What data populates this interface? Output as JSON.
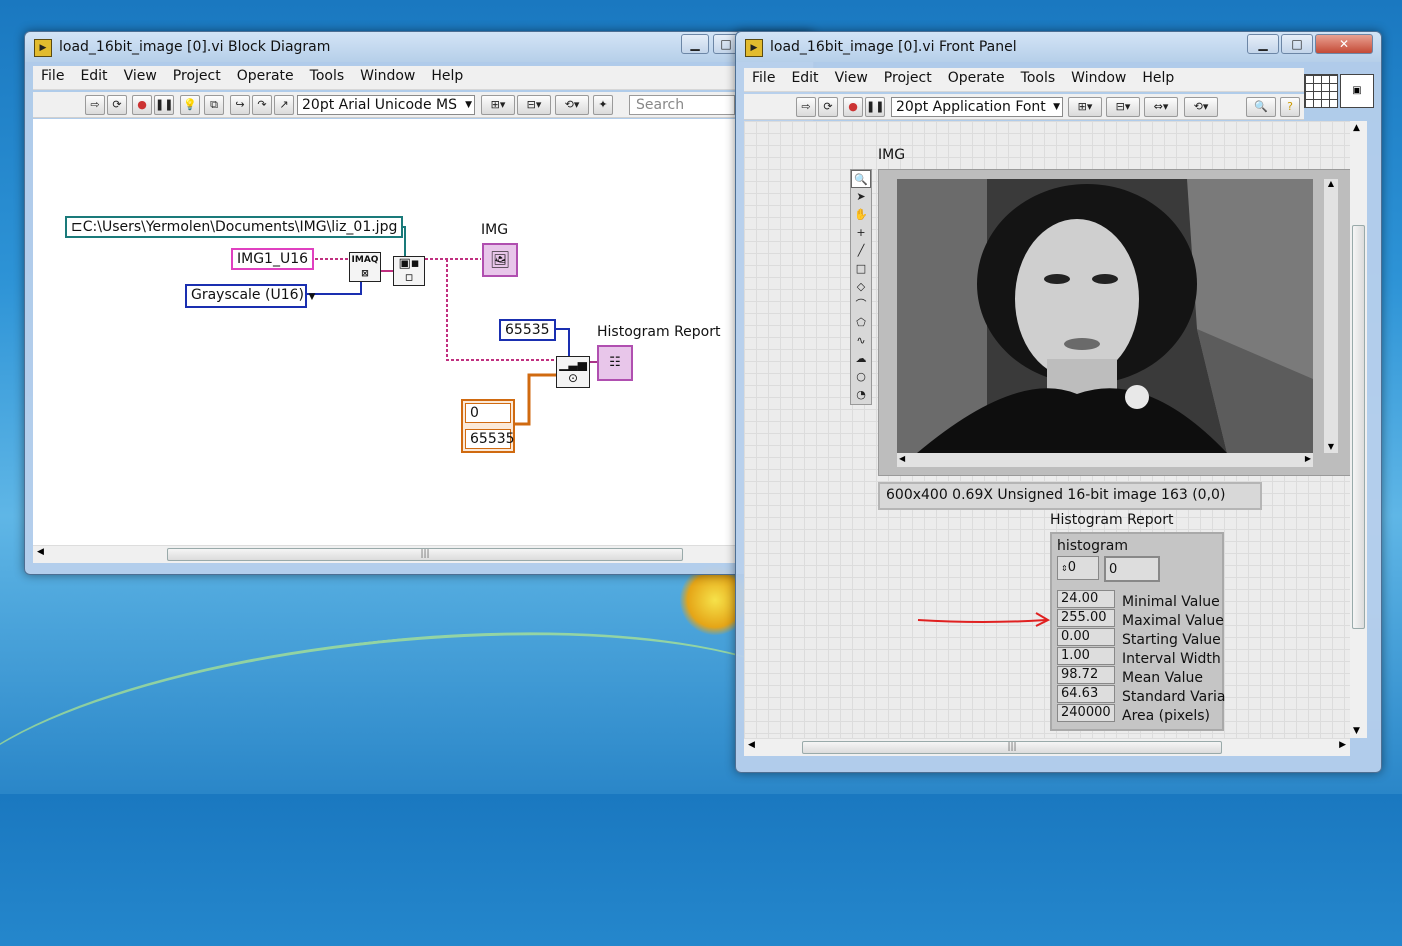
{
  "block_diagram": {
    "title": "load_16bit_image [0].vi Block Diagram",
    "menu": [
      "File",
      "Edit",
      "View",
      "Project",
      "Operate",
      "Tools",
      "Window",
      "Help"
    ],
    "font_ring": "20pt Arial Unicode MS",
    "search_placeholder": "Search",
    "path_constant": "C:\\Users\\Yermolen\\Documents\\IMG\\liz_01.jpg",
    "image_name_constant": "IMG1_U16",
    "image_type_constant": "Grayscale (U16)",
    "img_terminal_label": "IMG",
    "max_constant": "65535",
    "histogram_terminal_label": "Histogram Report",
    "range_cluster": [
      "0",
      "65535"
    ],
    "imaq_node_text": "IMAQ"
  },
  "front_panel": {
    "title": "load_16bit_image [0].vi Front Panel",
    "menu": [
      "File",
      "Edit",
      "View",
      "Project",
      "Operate",
      "Tools",
      "Window",
      "Help"
    ],
    "font_ring": "20pt Application Font",
    "img_label": "IMG",
    "status_text": "600x400 0.69X Unsigned 16-bit image 163    (0,0)",
    "histogram_label": "Histogram Report",
    "histogram_array_label": "histogram",
    "array_index": "0",
    "array_value": "0",
    "stats": [
      {
        "value": "24.00",
        "label": "Minimal Value"
      },
      {
        "value": "255.00",
        "label": "Maximal Value"
      },
      {
        "value": "0.00",
        "label": "Starting Value"
      },
      {
        "value": "1.00",
        "label": "Interval Width"
      },
      {
        "value": "98.72",
        "label": "Mean Value"
      },
      {
        "value": "64.63",
        "label": "Standard  Varia"
      },
      {
        "value": "240000",
        "label": "Area (pixels)"
      }
    ]
  },
  "colors": {
    "accent_annotation": "#e02020",
    "wire_pink": "#c03080",
    "wire_blue": "#1a2fb0",
    "wire_orange": "#d06a10",
    "wire_teal": "#1a7a7a"
  }
}
